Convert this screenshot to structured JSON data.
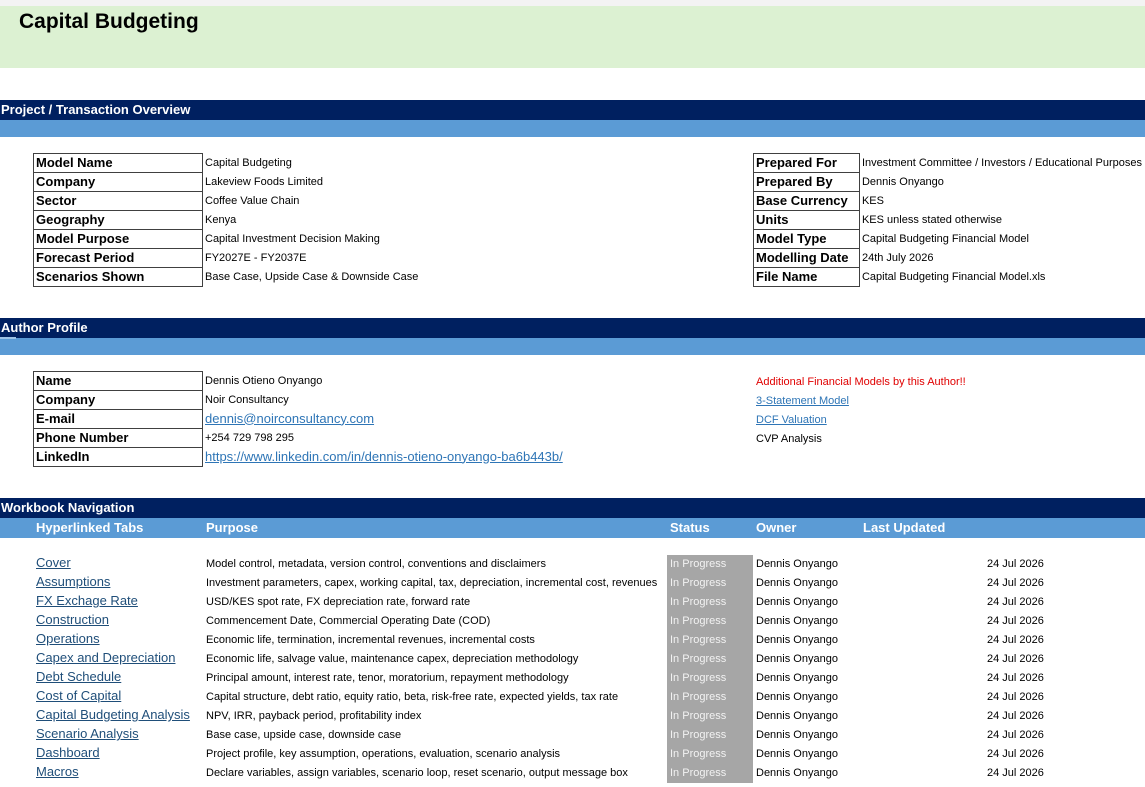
{
  "header": {
    "title": "Capital Budgeting"
  },
  "sections": {
    "overview": "Project / Transaction Overview",
    "author": "Author Profile",
    "navigation": "Workbook Navigation"
  },
  "overview": {
    "left": [
      {
        "label": "Model Name",
        "value": "Capital Budgeting"
      },
      {
        "label": "Company",
        "value": "Lakeview Foods Limited"
      },
      {
        "label": "Sector",
        "value": "Coffee Value Chain"
      },
      {
        "label": "Geography",
        "value": "Kenya"
      },
      {
        "label": "Model Purpose",
        "value": "Capital Investment Decision Making"
      },
      {
        "label": "Forecast Period",
        "value": "FY2027E - FY2037E"
      },
      {
        "label": "Scenarios Shown",
        "value": "Base Case, Upside Case & Downside Case"
      }
    ],
    "right": [
      {
        "label": "Prepared For",
        "value": "Investment Committee / Investors / Educational Purposes"
      },
      {
        "label": "Prepared By",
        "value": "Dennis Onyango"
      },
      {
        "label": "Base Currency",
        "value": "KES"
      },
      {
        "label": "Units",
        "value": "KES unless stated otherwise"
      },
      {
        "label": "Model Type",
        "value": "Capital Budgeting Financial Model"
      },
      {
        "label": "Modelling Date",
        "value": "24th July 2026"
      },
      {
        "label": "File Name",
        "value": "Capital Budgeting Financial Model.xls"
      }
    ]
  },
  "author": {
    "rows": [
      {
        "label": "Name",
        "value": "Dennis Otieno Onyango"
      },
      {
        "label": "Company",
        "value": "Noir Consultancy"
      },
      {
        "label": "E-mail",
        "value": "dennis@noirconsultancy.com"
      },
      {
        "label": "Phone Number",
        "value": "+254 729 798 295"
      },
      {
        "label": "LinkedIn",
        "value": "https://www.linkedin.com/in/dennis-otieno-onyango-ba6b443b/"
      }
    ],
    "more_title": "Additional Financial Models by this Author!!",
    "more_models": [
      "3-Statement Model",
      "DCF Valuation",
      "CVP Analysis"
    ]
  },
  "navigation": {
    "headers": {
      "tab": "Hyperlinked Tabs",
      "purpose": "Purpose",
      "status": "Status",
      "owner": "Owner",
      "updated": "Last Updated"
    },
    "rows": [
      {
        "tab": "Cover",
        "purpose": "Model control, metadata, version control, conventions and disclaimers",
        "status": "In Progress",
        "owner": "Dennis Onyango",
        "date": "24 Jul 2026"
      },
      {
        "tab": "Assumptions",
        "purpose": "Investment parameters, capex, working capital, tax, depreciation, incremental cost, revenues",
        "status": "In Progress",
        "owner": "Dennis Onyango",
        "date": "24 Jul 2026"
      },
      {
        "tab": "FX Exchage Rate",
        "purpose": "USD/KES spot rate, FX depreciation rate, forward rate",
        "status": "In Progress",
        "owner": "Dennis Onyango",
        "date": "24 Jul 2026"
      },
      {
        "tab": "Construction",
        "purpose": "Commencement Date, Commercial Operating Date (COD)",
        "status": "In Progress",
        "owner": "Dennis Onyango",
        "date": "24 Jul 2026"
      },
      {
        "tab": "Operations",
        "purpose": "Economic life, termination, incremental revenues, incremental costs",
        "status": "In Progress",
        "owner": "Dennis Onyango",
        "date": "24 Jul 2026"
      },
      {
        "tab": "Capex and Depreciation",
        "purpose": "Economic life, salvage value, maintenance capex, depreciation methodology",
        "status": "In Progress",
        "owner": "Dennis Onyango",
        "date": "24 Jul 2026"
      },
      {
        "tab": "Debt Schedule",
        "purpose": "Principal amount, interest rate, tenor, moratorium, repayment methodology",
        "status": "In Progress",
        "owner": "Dennis Onyango",
        "date": "24 Jul 2026"
      },
      {
        "tab": "Cost of Capital",
        "purpose": "Capital structure, debt ratio, equity ratio, beta, risk-free rate, expected yields, tax rate",
        "status": "In Progress",
        "owner": "Dennis Onyango",
        "date": "24 Jul 2026"
      },
      {
        "tab": "Capital Budgeting Analysis",
        "purpose": "NPV, IRR, payback period, profitability index",
        "status": "In Progress",
        "owner": "Dennis Onyango",
        "date": "24 Jul 2026"
      },
      {
        "tab": "Scenario Analysis",
        "purpose": "Base case, upside case, downside case",
        "status": "In Progress",
        "owner": "Dennis Onyango",
        "date": "24 Jul 2026"
      },
      {
        "tab": "Dashboard",
        "purpose": "Project profile, key assumption, operations, evaluation, scenario analysis",
        "status": "In Progress",
        "owner": "Dennis Onyango",
        "date": "24 Jul 2026"
      },
      {
        "tab": "Macros",
        "purpose": "Declare variables, assign variables, scenario loop, reset scenario, output message box",
        "status": "In Progress",
        "owner": "Dennis Onyango",
        "date": "24 Jul 2026"
      }
    ]
  }
}
